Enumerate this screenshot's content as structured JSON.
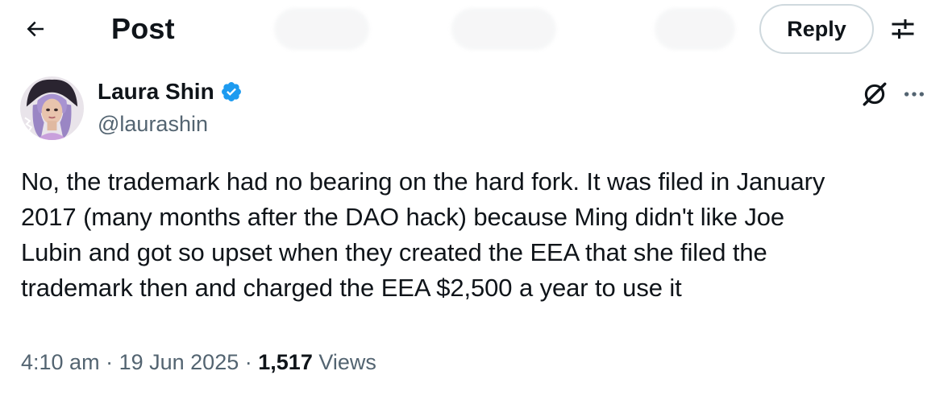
{
  "header": {
    "back_icon": "arrow-left-icon",
    "title": "Post",
    "reply_label": "Reply",
    "settings_icon": "sliders-icon"
  },
  "author": {
    "name": "Laura Shin",
    "handle": "@laurashin",
    "verified_icon": "verified-badge-icon",
    "verified_color": "#1d9bf0"
  },
  "actions": {
    "grok_icon": "grok-icon",
    "more_icon": "more-dots-icon"
  },
  "post": {
    "text": "No, the trademark had no bearing on the hard fork. It was filed in January\n2017 (many months after the DAO hack) because Ming didn't like Joe\nLubin and got so upset when they created the EEA that she filed the\ntrademark then and charged the EEA $2,500 a year to use it"
  },
  "meta": {
    "time": "4:10 am",
    "separator": "·",
    "date": "19 Jun 2025",
    "views_count": "1,517",
    "views_label": "Views"
  },
  "colors": {
    "text_primary": "#0f1419",
    "text_secondary": "#536471",
    "border": "#cfd9de"
  }
}
